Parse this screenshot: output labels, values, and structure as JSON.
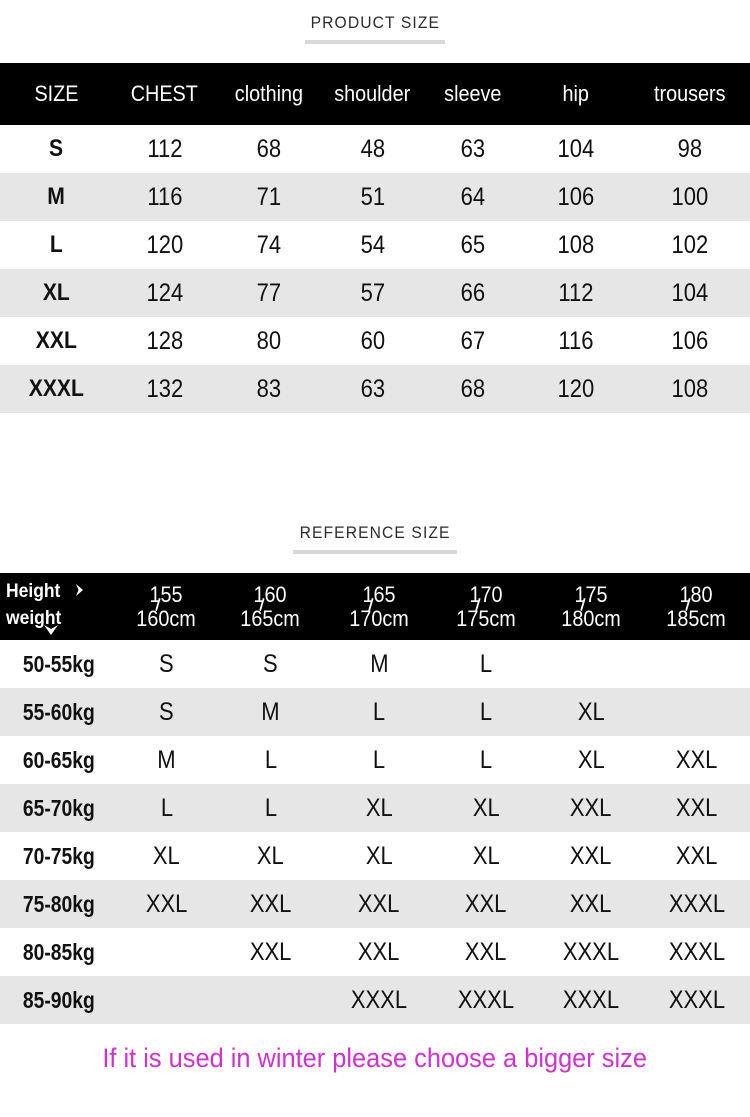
{
  "product_section": {
    "title": "PRODUCT SIZE",
    "columns": [
      "SIZE",
      "CHEST",
      "clothing",
      "shoulder",
      "sleeve",
      "hip",
      "trousers"
    ],
    "rows": [
      {
        "size": "S",
        "chest": "112",
        "clothing": "68",
        "shoulder": "48",
        "sleeve": "63",
        "hip": "104",
        "trousers": "98"
      },
      {
        "size": "M",
        "chest": "116",
        "clothing": "71",
        "shoulder": "51",
        "sleeve": "64",
        "hip": "106",
        "trousers": "100"
      },
      {
        "size": "L",
        "chest": "120",
        "clothing": "74",
        "shoulder": "54",
        "sleeve": "65",
        "hip": "108",
        "trousers": "102"
      },
      {
        "size": "XL",
        "chest": "124",
        "clothing": "77",
        "shoulder": "57",
        "sleeve": "66",
        "hip": "112",
        "trousers": "104"
      },
      {
        "size": "XXL",
        "chest": "128",
        "clothing": "80",
        "shoulder": "60",
        "sleeve": "67",
        "hip": "116",
        "trousers": "106"
      },
      {
        "size": "XXXL",
        "chest": "132",
        "clothing": "83",
        "shoulder": "63",
        "sleeve": "68",
        "hip": "120",
        "trousers": "108"
      }
    ]
  },
  "reference_section": {
    "title": "REFERENCE SIZE",
    "corner": {
      "height_label": "Height",
      "weight_label": "weight",
      "height_arrow_icon": "chevron-right-icon",
      "weight_arrow_icon": "chevron-down-icon"
    },
    "height_columns": [
      {
        "top": "155",
        "bottom": "160cm"
      },
      {
        "top": "160",
        "bottom": "165cm"
      },
      {
        "top": "165",
        "bottom": "170cm"
      },
      {
        "top": "170",
        "bottom": "175cm"
      },
      {
        "top": "175",
        "bottom": "180cm"
      },
      {
        "top": "180",
        "bottom": "185cm"
      }
    ],
    "rows": [
      {
        "weight": "50-55kg",
        "sizes": [
          "S",
          "S",
          "M",
          "L",
          "",
          ""
        ]
      },
      {
        "weight": "55-60kg",
        "sizes": [
          "S",
          "M",
          "L",
          "L",
          "XL",
          ""
        ]
      },
      {
        "weight": "60-65kg",
        "sizes": [
          "M",
          "L",
          "L",
          "L",
          "XL",
          "XXL"
        ]
      },
      {
        "weight": "65-70kg",
        "sizes": [
          "L",
          "L",
          "XL",
          "XL",
          "XXL",
          "XXL"
        ]
      },
      {
        "weight": "70-75kg",
        "sizes": [
          "XL",
          "XL",
          "XL",
          "XL",
          "XXL",
          "XXL"
        ]
      },
      {
        "weight": "75-80kg",
        "sizes": [
          "XXL",
          "XXL",
          "XXL",
          "XXL",
          "XXL",
          "XXXL"
        ]
      },
      {
        "weight": "80-85kg",
        "sizes": [
          "",
          "XXL",
          "XXL",
          "XXL",
          "XXXL",
          "XXXL"
        ]
      },
      {
        "weight": "85-90kg",
        "sizes": [
          "",
          "",
          "XXXL",
          "XXXL",
          "XXXL",
          "XXXL"
        ]
      }
    ]
  },
  "footer": {
    "note": "If it is used in winter please choose a bigger size"
  },
  "colors": {
    "header_bg": "#000000",
    "row_odd": "#ffffff",
    "row_even": "#e6e6e6",
    "note_pink": "#d131d1",
    "title_rule": "#d9d9d9"
  }
}
